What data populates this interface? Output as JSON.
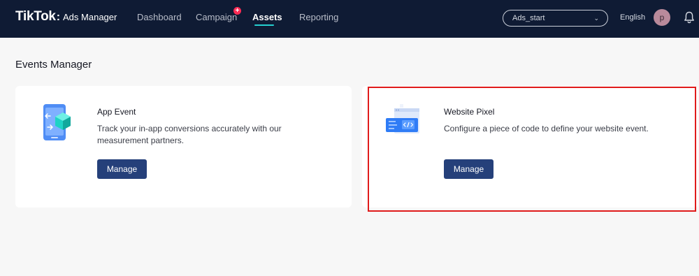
{
  "header": {
    "brand": "TikTok",
    "brand_separator": ":",
    "brand_sub": "Ads Manager",
    "nav": [
      "Dashboard",
      "Campaign",
      "Assets",
      "Reporting"
    ],
    "active_nav": "Assets",
    "campaign_badge": "+",
    "account_select": "Ads_start",
    "language": "English",
    "avatar_letter": "p"
  },
  "page": {
    "title": "Events Manager",
    "cards": [
      {
        "title": "App Event",
        "description": "Track your in-app conversions accurately with our measurement partners.",
        "button": "Manage",
        "icon": "mobile-app-icon"
      },
      {
        "title": "Website Pixel",
        "description": "Configure a piece of code to define your website event.",
        "button": "Manage",
        "icon": "browser-code-icon"
      }
    ]
  },
  "colors": {
    "header_bg": "#0f1b34",
    "accent_underline": "#25d0d0",
    "button": "#25407a",
    "badge": "#fe2c55",
    "highlight": "#e01b1b"
  }
}
